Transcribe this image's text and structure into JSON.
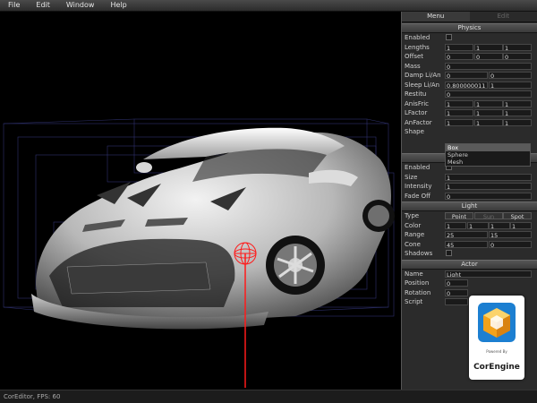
{
  "menu": [
    "File",
    "Edit",
    "Window",
    "Help"
  ],
  "status": "CorEditor, FPS: 60",
  "panel": {
    "tabs": [
      "Menu",
      "Edit"
    ],
    "physics": {
      "header": "Physics",
      "rows": [
        {
          "label": "Enabled",
          "values": []
        },
        {
          "label": "Lengths",
          "values": [
            "1",
            "1",
            "1"
          ]
        },
        {
          "label": "Offset",
          "values": [
            "0",
            "0",
            "0"
          ]
        },
        {
          "label": "Mass",
          "values": [
            "0"
          ]
        },
        {
          "label": "Damp Li/An",
          "values": [
            "0",
            "0"
          ]
        },
        {
          "label": "Sleep Li/An",
          "values": [
            "0.800000011",
            "1"
          ]
        },
        {
          "label": "Restitu",
          "values": [
            "0"
          ]
        },
        {
          "label": "AnisFric",
          "values": [
            "1",
            "1",
            "1"
          ]
        },
        {
          "label": "LFactor",
          "values": [
            "1",
            "1",
            "1"
          ]
        },
        {
          "label": "AnFactor",
          "values": [
            "1",
            "1",
            "1"
          ]
        }
      ],
      "shape_label": "Shape",
      "shapes": [
        "Box",
        "Sphere",
        "Mesh"
      ],
      "shape_selected": "Box"
    },
    "shaft": {
      "header": "Shaft",
      "rows": [
        {
          "label": "Enabled",
          "values": []
        },
        {
          "label": "Size",
          "values": [
            "1"
          ]
        },
        {
          "label": "Intensity",
          "values": [
            "1"
          ]
        },
        {
          "label": "Fade Off",
          "values": [
            "0"
          ]
        }
      ]
    },
    "light": {
      "header": "Light",
      "type_label": "Type",
      "types": [
        "Point",
        "Sun",
        "Spot"
      ],
      "rows": [
        {
          "label": "Color",
          "values": [
            "1",
            "1",
            "1",
            "1"
          ]
        },
        {
          "label": "Range",
          "values": [
            "25",
            "15"
          ]
        },
        {
          "label": "Cone",
          "values": [
            "45",
            "0"
          ]
        },
        {
          "label": "Shadows",
          "values": []
        }
      ]
    },
    "actor": {
      "header": "Actor",
      "rows": [
        {
          "label": "Name",
          "values": [
            "Light"
          ]
        },
        {
          "label": "Position",
          "values": [
            "0"
          ]
        },
        {
          "label": "Rotation",
          "values": [
            "0"
          ]
        },
        {
          "label": "Script",
          "values": [
            ""
          ]
        }
      ]
    }
  },
  "logo": {
    "caption": "Powered By",
    "name": "CorEngine"
  }
}
